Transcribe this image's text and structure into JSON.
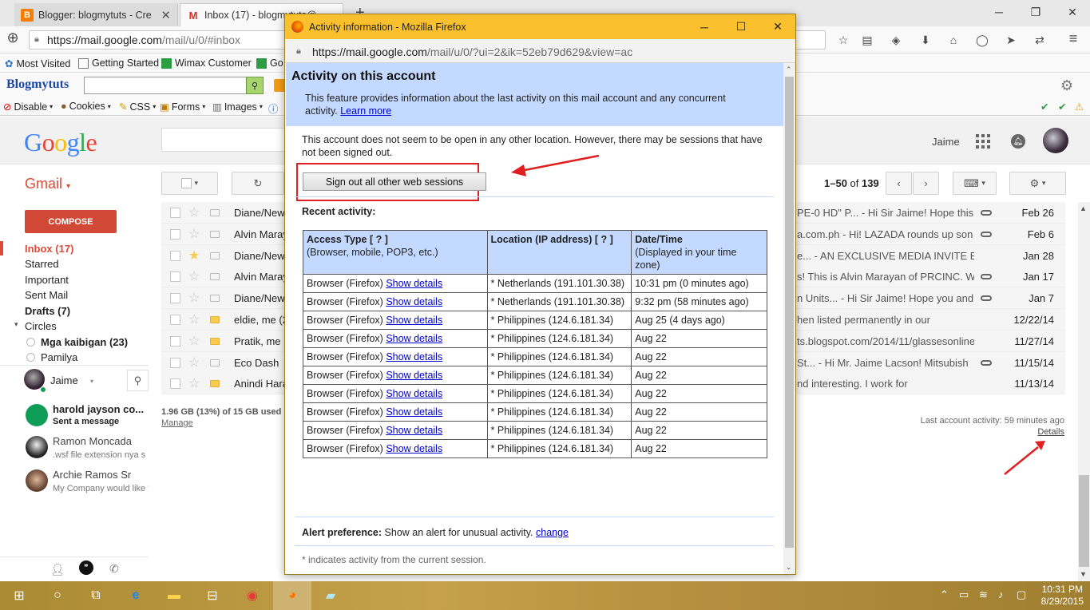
{
  "browser": {
    "tabs": [
      {
        "label": "Blogger: blogmytuts - Cre",
        "active": false
      },
      {
        "label": "Inbox (17) - blogmytuts@",
        "active": true
      }
    ],
    "url": {
      "host": "https://mail.google.com",
      "path": "/mail/u/0/#inbox"
    },
    "bookmarks": [
      "Most Visited",
      "Getting Started",
      "Wimax Customer",
      "Go"
    ],
    "blogger_bar": {
      "name": "Blogmytuts"
    },
    "devbar": [
      "Disable",
      "Cookies",
      "CSS",
      "Forms",
      "Images"
    ]
  },
  "gmail": {
    "user": "Jaime",
    "label": "Gmail",
    "compose": "COMPOSE",
    "nav": [
      {
        "label": "Inbox (17)",
        "style": "sel"
      },
      {
        "label": "Starred",
        "style": ""
      },
      {
        "label": "Important",
        "style": ""
      },
      {
        "label": "Sent Mail",
        "style": ""
      },
      {
        "label": "Drafts (7)",
        "style": "b"
      },
      {
        "label": "Circles",
        "style": ""
      }
    ],
    "circles": [
      "Mga kaibigan (23)",
      "Pamilya"
    ],
    "hangouts": {
      "me": "Jaime",
      "contacts": [
        {
          "name": "harold jayson co...",
          "sub": "Sent a message"
        },
        {
          "name": "Ramon Moncada",
          "sub": ".wsf file extension nya s"
        },
        {
          "name": "Archie Ramos Sr",
          "sub": "My Company would like to"
        }
      ]
    },
    "pagination": {
      "range": "1–50",
      "of": "of",
      "total": "139"
    },
    "emails": [
      {
        "sender": "Diane/New...",
        "snippet": "PE-0 HD\" P... - Hi Sir Jaime! Hope this",
        "date": "Feb 26",
        "starred": false,
        "labeled": false,
        "attachment": true
      },
      {
        "sender": "Alvin Maray",
        "snippet": "a.com.ph - Hi! LAZADA rounds up son",
        "date": "Feb 6",
        "starred": false,
        "labeled": false,
        "attachment": true
      },
      {
        "sender": "Diane/New...",
        "snippet": "e... - AN EXCLUSIVE MEDIA INVITE E",
        "date": "Jan 28",
        "starred": true,
        "labeled": false,
        "attachment": false
      },
      {
        "sender": "Alvin Maray",
        "snippet": "s! This is Alvin Marayan of PRCINC. W",
        "date": "Jan 17",
        "starred": false,
        "labeled": false,
        "attachment": true
      },
      {
        "sender": "Diane/New...",
        "snippet": "n Units... - Hi Sir Jaime! Hope you and",
        "date": "Jan 7",
        "starred": false,
        "labeled": false,
        "attachment": true
      },
      {
        "sender": "eldie, me (2",
        "snippet": "hen listed permanently in our",
        "date": "12/22/14",
        "starred": false,
        "labeled": true,
        "attachment": false
      },
      {
        "sender": "Pratik, me",
        "snippet": "ts.blogspot.com/2014/11/glassesonline",
        "date": "11/27/14",
        "starred": false,
        "labeled": true,
        "attachment": false
      },
      {
        "sender": "Eco Dash",
        "snippet": "St... - Hi Mr. Jaime Lacson! Mitsubish",
        "date": "11/15/14",
        "starred": false,
        "labeled": false,
        "attachment": true
      },
      {
        "sender": "Anindi Hara",
        "snippet": "nd interesting. I work for",
        "date": "11/13/14",
        "starred": false,
        "labeled": true,
        "attachment": false
      }
    ],
    "storage": "1.96 GB (13%) of 15 GB used",
    "manage": "Manage",
    "last_activity": "Last account activity: 59 minutes ago",
    "details": "Details"
  },
  "popup": {
    "title": "Activity information - Mozilla Firefox",
    "url": {
      "host": "https://mail.google.com",
      "path": "/mail/u/0/?ui=2&ik=52eb79d629&view=ac"
    },
    "heading": "Activity on this account",
    "desc": "This feature provides information about the last activity on this mail account and any concurrent activity.",
    "learn_more": "Learn more",
    "info": "This account does not seem to be open in any other location. However, there may be sessions that have not been signed out.",
    "signout_button": "Sign out all other web sessions",
    "recent_heading": "Recent activity:",
    "columns": {
      "access": "Access Type [ ? ]",
      "access_sub": "(Browser, mobile, POP3, etc.)",
      "location": "Location (IP address) [ ? ]",
      "date": "Date/Time",
      "date_sub": "(Displayed in your time zone)"
    },
    "show_details": "Show details",
    "rows": [
      {
        "access": "Browser (Firefox)",
        "location": "* Netherlands (191.101.30.38)",
        "date": "10:31 pm (0 minutes ago)"
      },
      {
        "access": "Browser (Firefox)",
        "location": "* Netherlands (191.101.30.38)",
        "date": "9:32 pm (58 minutes ago)"
      },
      {
        "access": "Browser (Firefox)",
        "location": "* Philippines (124.6.181.34)",
        "date": "Aug 25 (4 days ago)"
      },
      {
        "access": "Browser (Firefox)",
        "location": "* Philippines (124.6.181.34)",
        "date": "Aug 22"
      },
      {
        "access": "Browser (Firefox)",
        "location": "* Philippines (124.6.181.34)",
        "date": "Aug 22"
      },
      {
        "access": "Browser (Firefox)",
        "location": "* Philippines (124.6.181.34)",
        "date": "Aug 22"
      },
      {
        "access": "Browser (Firefox)",
        "location": "* Philippines (124.6.181.34)",
        "date": "Aug 22"
      },
      {
        "access": "Browser (Firefox)",
        "location": "* Philippines (124.6.181.34)",
        "date": "Aug 22"
      },
      {
        "access": "Browser (Firefox)",
        "location": "* Philippines (124.6.181.34)",
        "date": "Aug 22"
      },
      {
        "access": "Browser (Firefox)",
        "location": "* Philippines (124.6.181.34)",
        "date": "Aug 22"
      }
    ],
    "alert_label": "Alert preference:",
    "alert_text": "Show an alert for unusual activity.",
    "alert_change": "change",
    "footnote": "* indicates activity from the current session."
  },
  "taskbar": {
    "time": "10:31 PM",
    "date": "8/29/2015"
  },
  "colors": {
    "accent_red": "#dd4b39",
    "popup_title": "#fbc02d",
    "banner": "#c3d9ff",
    "annotation": "#e02020"
  }
}
